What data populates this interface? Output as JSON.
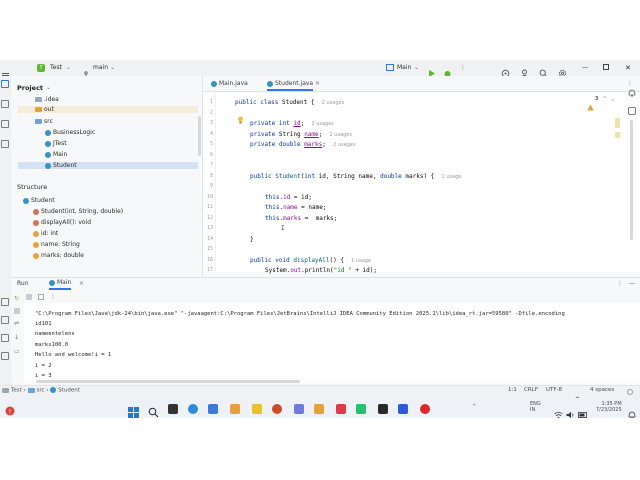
{
  "titlebar": {
    "project_badge": "T",
    "project_name": "Test",
    "branch_icon": "branch-icon",
    "branch": "main",
    "run_config": "Main"
  },
  "project_panel": {
    "title": "Project",
    "items": [
      {
        "label": ".idea"
      },
      {
        "label": "out"
      },
      {
        "label": "src"
      },
      {
        "label": "BusinessLogic"
      },
      {
        "label": "JTest"
      },
      {
        "label": "Main"
      },
      {
        "label": "Student"
      }
    ]
  },
  "structure_panel": {
    "title": "Structure",
    "root": "Student",
    "items": [
      {
        "label": "Student(int, String, double)"
      },
      {
        "label": "displayAll(): void"
      },
      {
        "label": "id: int"
      },
      {
        "label": "name: String"
      },
      {
        "label": "marks: double"
      }
    ]
  },
  "editor": {
    "tabs": [
      {
        "label": "Main.java"
      },
      {
        "label": "Student.java"
      }
    ],
    "warning_count": "3",
    "line_numbers": [
      "1",
      "2",
      "3",
      "4",
      "5",
      "6",
      "7",
      "8",
      "9",
      "10",
      "11",
      "12",
      "13",
      "14",
      "15",
      "16",
      "17"
    ],
    "hints": {
      "class_usages": "2 usages",
      "id_usages": "2 usages",
      "name_usages": "2 usages",
      "marks_usages": "2 usages",
      "ctor_usage": "1 usage",
      "display_usage": "1 usage"
    }
  },
  "run": {
    "tab_label": "Run",
    "config_tab": "Main",
    "console_lines": [
      "\"C:\\Program Files\\Java\\jdk-24\\bin\\java.exe\" \"-javaagent:C:\\Program Files\\JetBrains\\IntelliJ IDEA Community Edition 2025.1\\lib\\idea_rt.jar=59580\" -Dfile.encoding",
      "id101",
      "nameentelens",
      "marks100.0",
      "Hello and welcome!i = 1",
      "i = 2",
      "i = 3"
    ]
  },
  "statusbar": {
    "crumbs": [
      "Test",
      "src",
      "Student"
    ],
    "position": "1:1",
    "line_sep": "CRLF",
    "encoding": "UTF-8",
    "indent": "4 spaces"
  },
  "taskbar": {
    "lang": "ENG",
    "region": "IN",
    "time": "1:35 PM",
    "date": "7/23/2025"
  },
  "colors": {
    "accent": "#3574f0",
    "keyword": "#0033b3",
    "field": "#871094",
    "method": "#00627a"
  }
}
